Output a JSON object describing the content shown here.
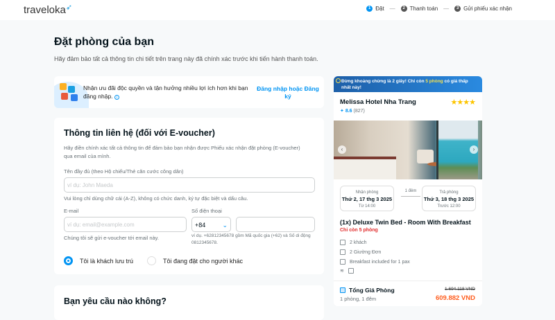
{
  "header": {
    "logo": "traveloka",
    "steps": [
      {
        "num": "1",
        "label": "Đặt"
      },
      {
        "num": "2",
        "label": "Thanh toán"
      },
      {
        "num": "3",
        "label": "Gửi phiếu xác nhận"
      }
    ]
  },
  "page": {
    "title": "Đặt phòng của bạn",
    "subtitle": "Hãy đảm bảo tất cả thông tin chi tiết trên trang này đã chính xác trước khi tiến hành thanh toán."
  },
  "banner": {
    "text": "Nhận ưu đãi độc quyền và tận hưởng nhiều lợi ích hơn khi bạn đăng nhập.",
    "link": "Đăng nhập hoặc Đăng ký"
  },
  "contact": {
    "title": "Thông tin liên hệ (đối với E-voucher)",
    "desc": "Hãy điền chính xác tất cả thông tin để đảm bảo bạn nhận được Phiếu xác nhận  đặt phòng (E-voucher) qua email của mình.",
    "name_label": "Tên đầy đủ (theo Hộ chiếu/Thẻ căn cước công dân)",
    "name_placeholder": "ví dụ: John Maeda",
    "name_hint": "Vui lòng chỉ dùng chữ cái (A-Z), không có chức danh, ký tự đặc biệt và dấu câu.",
    "email_label": "E-mail",
    "email_placeholder": "ví dụ: email@example.com",
    "email_hint": "Chúng tôi sẽ gửi e-voucher tới email này.",
    "phone_label": "Số điện thoại",
    "phone_code": "+84",
    "phone_hint": "ví dụ. +62812345678 gồm Mã quốc gia (+62) và Số di động 0812345678.",
    "radio_self": "Tôi là khách lưu trú",
    "radio_other": "Tôi đang đặt cho người khác"
  },
  "requests": {
    "title": "Bạn yêu cầu nào không?"
  },
  "summary": {
    "urgency_pre": "Đừng khoảng chừng là 2 giây! Chỉ còn ",
    "urgency_hl": "5 phòng",
    "urgency_post": " có giá thấp nhất này!",
    "hotel": "Melissa Hotel Nha Trang",
    "stars": "★★★★",
    "rating": "8.6",
    "reviews": "(827)",
    "checkin_label": "Nhận phòng",
    "checkin_date": "Thứ 2, 17 thg 3 2025",
    "checkin_time": "Từ 14:00",
    "nights": "1 đêm",
    "checkout_label": "Trả phòng",
    "checkout_date": "Thứ 3, 18 thg 3 2025",
    "checkout_time": "Trước 12:00",
    "room": "(1x) Deluxe Twin Bed - Room With Breakfast",
    "rooms_left": "Chỉ còn 5 phòng",
    "features": [
      "2 khách",
      "2 Giường Đơn",
      "Breakfast included for 1 pax"
    ],
    "total_label": "Tổng Giá Phòng",
    "total_sub": "1 phòng, 1 đêm",
    "old_price": "1.694.118 VND",
    "price": "609.882 VND"
  }
}
